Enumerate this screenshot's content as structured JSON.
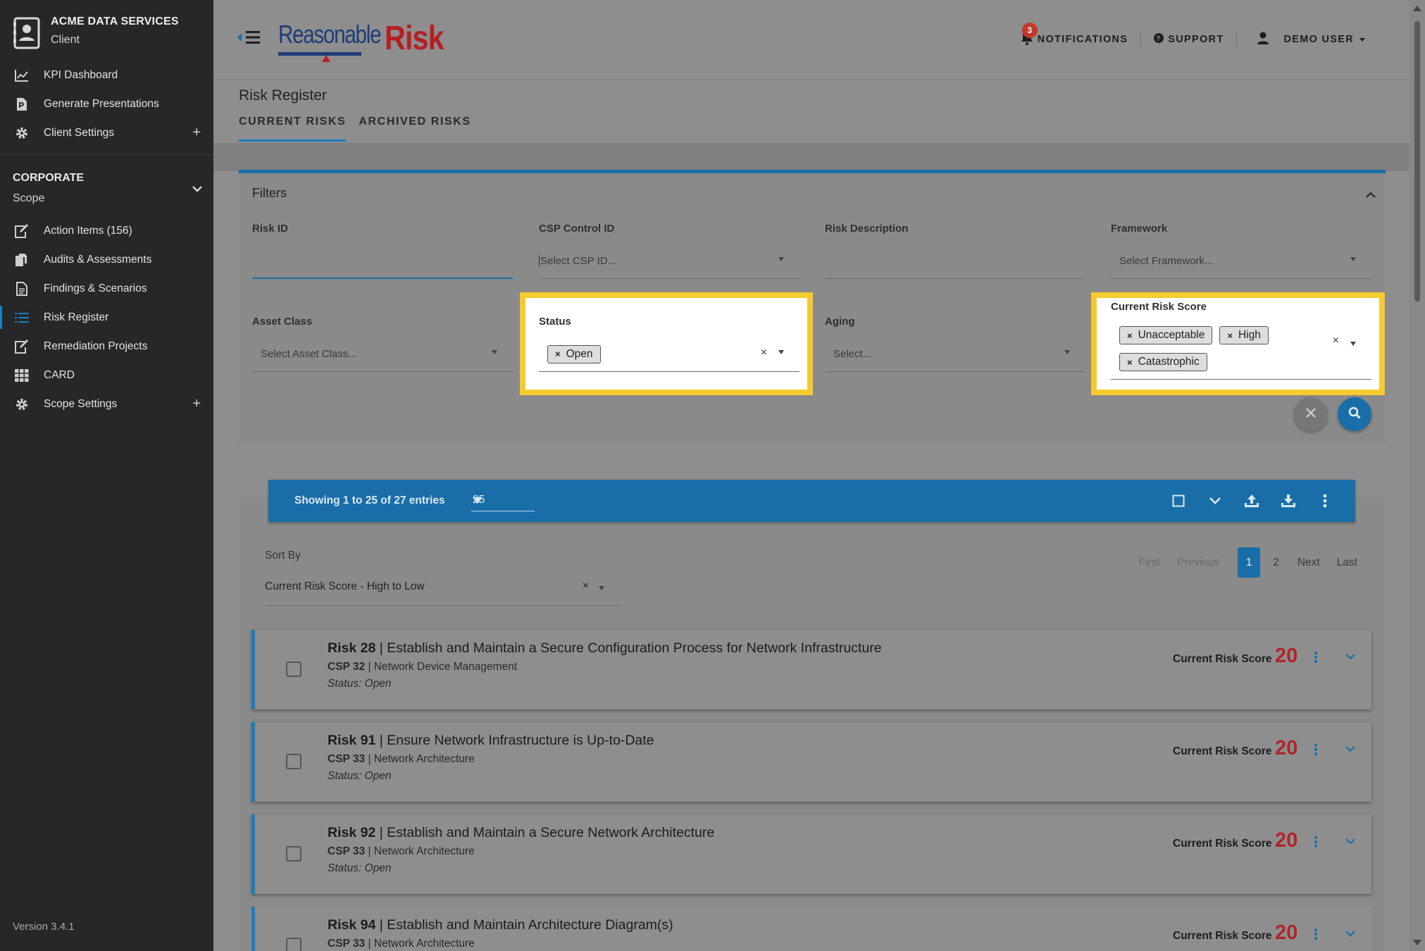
{
  "sidebar": {
    "client_name": "ACME DATA SERVICES",
    "client_sub": "Client",
    "client_items": [
      {
        "label": "KPI Dashboard",
        "icon": "chart-line-icon"
      },
      {
        "label": "Generate Presentations",
        "icon": "file-powerpoint-icon"
      },
      {
        "label": "Client Settings",
        "icon": "gear-icon",
        "plus": "+"
      }
    ],
    "scope_title": "CORPORATE",
    "scope_sub": "Scope",
    "scope_items": [
      {
        "label": "Action Items (156)",
        "icon": "edit-icon"
      },
      {
        "label": "Audits & Assessments",
        "icon": "copy-files-icon"
      },
      {
        "label": "Findings & Scenarios",
        "icon": "document-icon"
      },
      {
        "label": "Risk Register",
        "icon": "list-icon"
      },
      {
        "label": "Remediation Projects",
        "icon": "edit-icon"
      },
      {
        "label": "CARD",
        "icon": "grid-icon"
      },
      {
        "label": "Scope Settings",
        "icon": "gear-icon",
        "plus": "+"
      }
    ],
    "version": "Version 3.4.1"
  },
  "header": {
    "logo_part1": "Reasonable",
    "logo_part2": "Risk",
    "notifications_label": "NOTIFICATIONS",
    "notifications_count": "3",
    "support_label": "SUPPORT",
    "user_label": "DEMO USER"
  },
  "page": {
    "title": "Risk Register",
    "tabs": [
      "CURRENT RISKS",
      "ARCHIVED RISKS"
    ]
  },
  "filters": {
    "title": "Filters",
    "risk_id_label": "Risk ID",
    "csp_label": "CSP Control ID",
    "csp_placeholder": "Select CSP ID...",
    "desc_label": "Risk Description",
    "framework_label": "Framework",
    "framework_placeholder": "Select Framework...",
    "asset_label": "Asset Class",
    "asset_placeholder": "Select Asset Class...",
    "status_label": "Status",
    "status_chips": [
      "Open"
    ],
    "aging_label": "Aging",
    "aging_placeholder": "Select...",
    "score_label": "Current Risk Score",
    "score_chips": [
      "Unacceptable",
      "High",
      "Catastrophic"
    ],
    "chip_x": "×",
    "clear_x": "×"
  },
  "results": {
    "showing": "Showing 1 to 25 of 27 entries",
    "page_size": "25",
    "sort_label": "Sort By",
    "sort_value": "Current Risk Score - High to Low",
    "pager": {
      "first": "First",
      "previous": "Previous",
      "current": "1",
      "page2": "2",
      "next": "Next",
      "last": "Last"
    },
    "score_label": "Current Risk Score",
    "risks": [
      {
        "id": "Risk 28",
        "title": "Establish and Maintain a Secure Configuration Process for Network Infrastructure",
        "csp": "CSP 32",
        "csp_name": "Network Device Management",
        "status": "Status: Open",
        "score": "20"
      },
      {
        "id": "Risk 91",
        "title": "Ensure Network Infrastructure is Up-to-Date",
        "csp": "CSP 33",
        "csp_name": "Network Architecture",
        "status": "Status: Open",
        "score": "20"
      },
      {
        "id": "Risk 92",
        "title": "Establish and Maintain a Secure Network Architecture",
        "csp": "CSP 33",
        "csp_name": "Network Architecture",
        "status": "Status: Open",
        "score": "20"
      },
      {
        "id": "Risk 94",
        "title": "Establish and Maintain Architecture Diagram(s)",
        "csp": "CSP 33",
        "csp_name": "Network Architecture",
        "status": "",
        "score": "20"
      }
    ]
  },
  "colors": {
    "accent": "#1a6ea8",
    "highlight": "#f6cb2f",
    "score": "#b0242a",
    "sidebar": "#262728"
  }
}
